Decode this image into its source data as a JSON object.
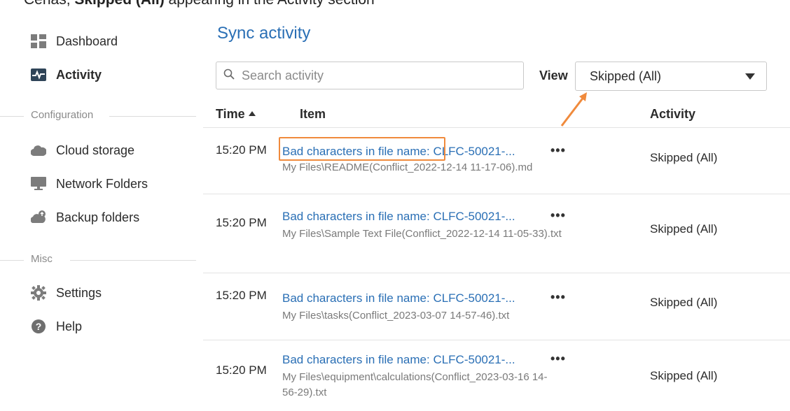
{
  "top_caption": {
    "pre": "Cenas, ",
    "bold": "Skipped (All)",
    "post": " appearing in the Activity section"
  },
  "sidebar": {
    "items": [
      {
        "label": "Dashboard",
        "icon": "dashboard-icon"
      },
      {
        "label": "Activity",
        "icon": "activity-icon",
        "active": true
      }
    ],
    "configuration_label": "Configuration",
    "config_items": [
      {
        "label": "Cloud storage",
        "icon": "cloud-icon"
      },
      {
        "label": "Network Folders",
        "icon": "monitor-icon"
      },
      {
        "label": "Backup folders",
        "icon": "backup-icon"
      }
    ],
    "misc_label": "Misc",
    "misc_items": [
      {
        "label": "Settings",
        "icon": "gear-icon"
      },
      {
        "label": "Help",
        "icon": "help-icon"
      }
    ]
  },
  "main": {
    "title": "Sync activity",
    "search": {
      "placeholder": "Search activity",
      "value": ""
    },
    "view_label": "View",
    "view_selected": "Skipped (All)",
    "columns": {
      "time": "Time",
      "item": "Item",
      "activity": "Activity"
    },
    "rows": [
      {
        "time": "15:20 PM",
        "title": "Bad characters in file name: CLFC-50021-...",
        "path": "My Files\\README(Conflict_2022-12-14 11-17-06).md",
        "activity": "Skipped (All)"
      },
      {
        "time": "15:20 PM",
        "title": "Bad characters in file name: CLFC-50021-...",
        "path": "My Files\\Sample Text File(Conflict_2022-12-14 11-05-33).txt",
        "activity": "Skipped (All)"
      },
      {
        "time": "15:20 PM",
        "title": "Bad characters in file name: CLFC-50021-...",
        "path": "My Files\\tasks(Conflict_2023-03-07 14-57-46).txt",
        "activity": "Skipped (All)"
      },
      {
        "time": "15:20 PM",
        "title": "Bad characters in file name: CLFC-50021-...",
        "path": "My Files\\equipment\\calculations(Conflict_2023-03-16 14-56-29).txt",
        "activity": "Skipped (All)"
      }
    ],
    "more_label": "•••"
  },
  "colors": {
    "accent": "#2a6fb5",
    "annotation": "#f08a3c"
  }
}
